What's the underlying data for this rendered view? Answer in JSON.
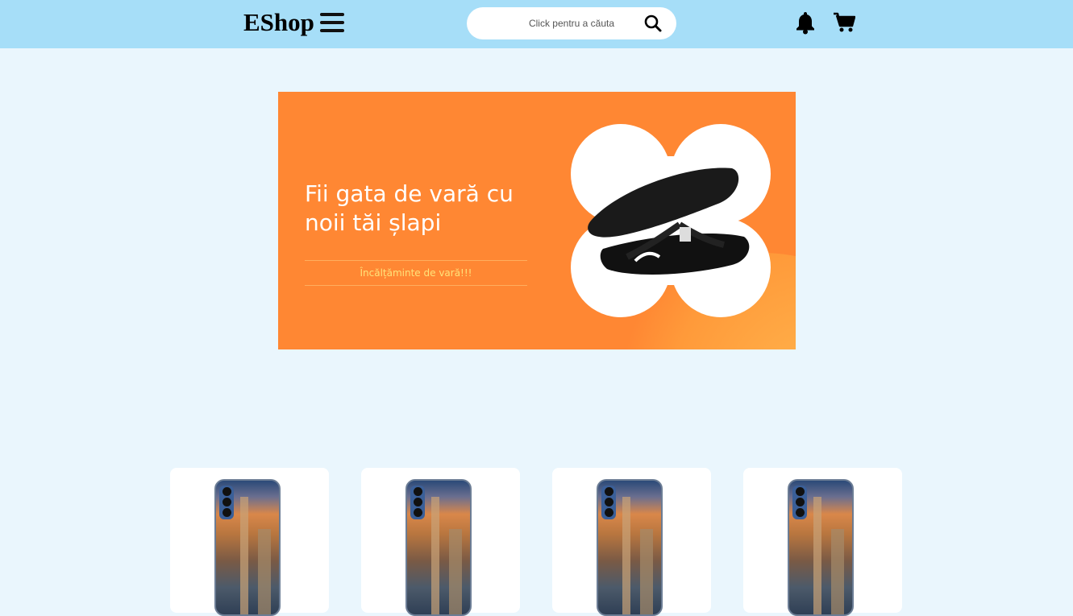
{
  "header": {
    "logo": "EShop",
    "search_placeholder": "Click pentru a căuta",
    "icons": [
      "menu-icon",
      "search-icon",
      "bell-icon",
      "cart-icon"
    ]
  },
  "banner": {
    "headline": "Fii gata de vară cu noii tăi șlapi",
    "subtitle": "Încălțăminte de vară!!!",
    "colors": {
      "background": "#ff8733",
      "subtitle": "#ffe37a"
    }
  },
  "products": [
    {
      "image": "phone-case-city"
    },
    {
      "image": "phone-case-city"
    },
    {
      "image": "phone-case-city"
    },
    {
      "image": "phone-case-city"
    }
  ],
  "colors": {
    "nav": "#a6def8",
    "page": "#eaf6fd"
  }
}
